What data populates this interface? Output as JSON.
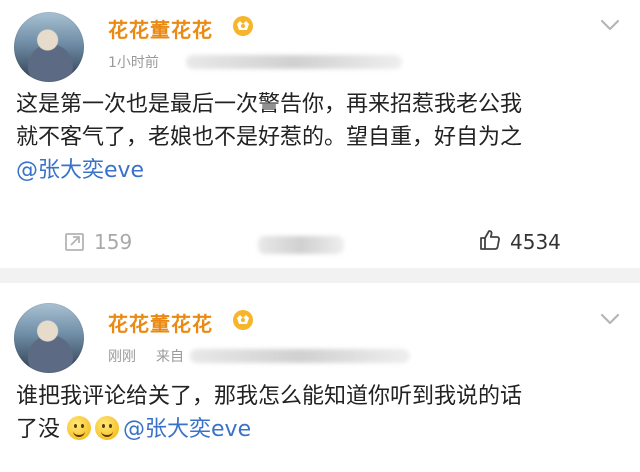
{
  "posts": [
    {
      "username": "花花董花花",
      "time": "1小时前",
      "text_line1": "这是第一次也是最后一次警告你，再来招惹我老公我",
      "text_line2": "就不客气了，老娘也不是好惹的。望自重，好自为之",
      "mention": "@张大奕eve",
      "repost_count": "159",
      "like_count": "4534",
      "icons": [
        "avatar",
        "vip-badge-icon",
        "chevron-down-icon",
        "repost-icon",
        "like-icon"
      ]
    },
    {
      "username": "花花董花花",
      "time": "刚刚",
      "source_prefix": "来自",
      "text_line1": "谁把我评论给关了，那我怎么能知道你听到我说的话",
      "text_line2_prefix": "了没",
      "mention": "@张大奕eve",
      "icons": [
        "avatar",
        "vip-badge-icon",
        "chevron-down-icon",
        "smile-emoji-icon"
      ]
    }
  ],
  "colors": {
    "username": "#ea8a13",
    "mention": "#3a72c9",
    "meta": "#9a9a9a",
    "background": "#f2f2f2"
  }
}
